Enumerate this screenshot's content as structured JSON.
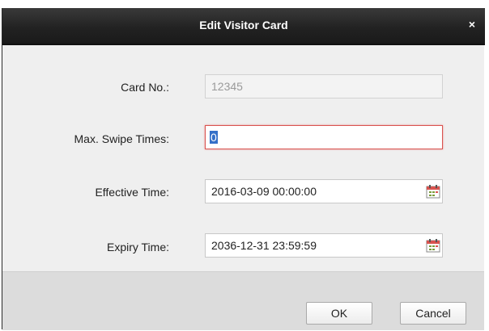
{
  "dialog": {
    "title": "Edit Visitor Card",
    "close_symbol": "×"
  },
  "form": {
    "card_no": {
      "label": "Card No.:",
      "value": "12345",
      "disabled": true
    },
    "max_swipe": {
      "label": "Max. Swipe Times:",
      "value": "0"
    },
    "effective_time": {
      "label": "Effective Time:",
      "value": "2016-03-09 00:00:00",
      "icon": "calendar-icon"
    },
    "expiry_time": {
      "label": "Expiry Time:",
      "value": "2036-12-31 23:59:59",
      "icon": "calendar-icon"
    }
  },
  "footer": {
    "ok_label": "OK",
    "cancel_label": "Cancel"
  },
  "colors": {
    "titlebar": "#222222",
    "body": "#efefef",
    "footer": "#dcdcdc",
    "focus_border": "#d9534f",
    "selection": "#3470c8"
  }
}
